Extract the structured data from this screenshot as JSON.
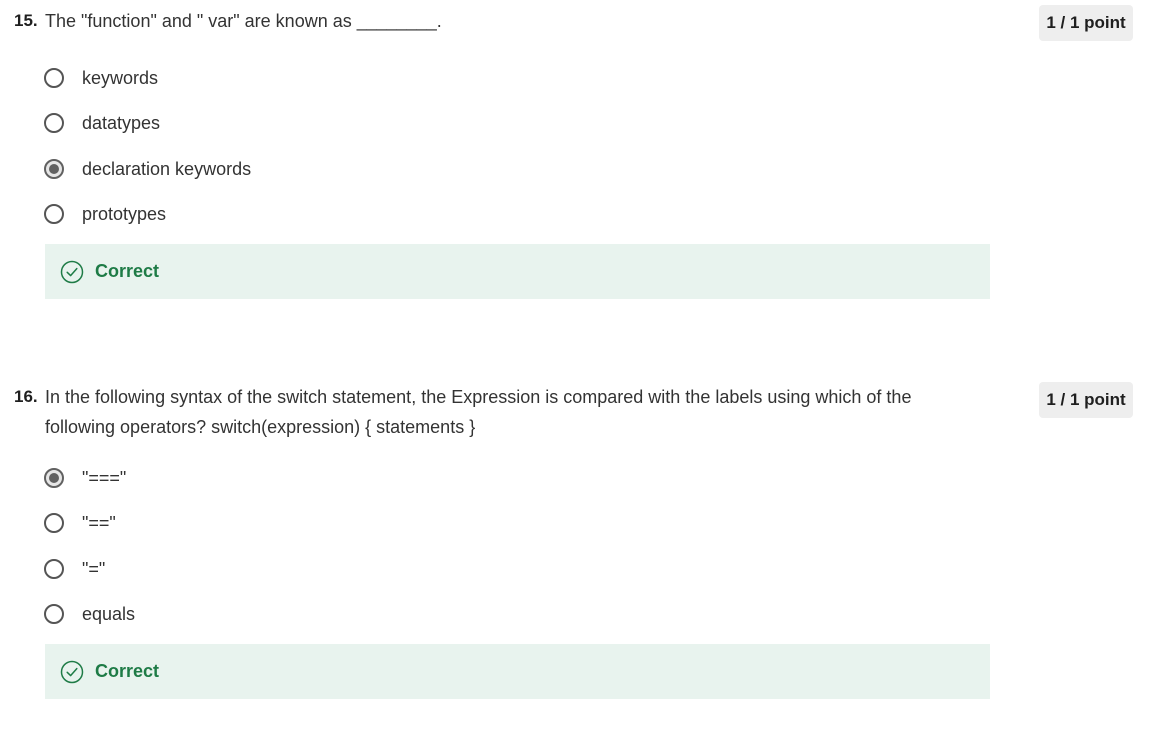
{
  "questions": [
    {
      "number": "15.",
      "text": "The \"function\" and \" var\" are known as ________.",
      "points": "1 / 1 point",
      "options": [
        {
          "label": "keywords",
          "selected": false
        },
        {
          "label": "datatypes",
          "selected": false
        },
        {
          "label": "declaration keywords",
          "selected": true
        },
        {
          "label": "prototypes",
          "selected": false
        }
      ],
      "feedback": {
        "label": "Correct",
        "icon": "check-circle-icon"
      }
    },
    {
      "number": "16.",
      "text": "In the following syntax of the switch statement, the Expression is compared with the labels using which of the following operators? switch(expression) { statements }",
      "points": "1 / 1 point",
      "options": [
        {
          "label": "\"===\"",
          "selected": true
        },
        {
          "label": "\"==\"",
          "selected": false
        },
        {
          "label": "\"=\"",
          "selected": false
        },
        {
          "label": "equals",
          "selected": false
        }
      ],
      "feedback": {
        "label": "Correct",
        "icon": "check-circle-icon"
      }
    }
  ],
  "colors": {
    "correct_text": "#1e7b46",
    "correct_background": "#e8f3ee",
    "badge_background": "#eeeeee",
    "radio_border": "#555555"
  }
}
